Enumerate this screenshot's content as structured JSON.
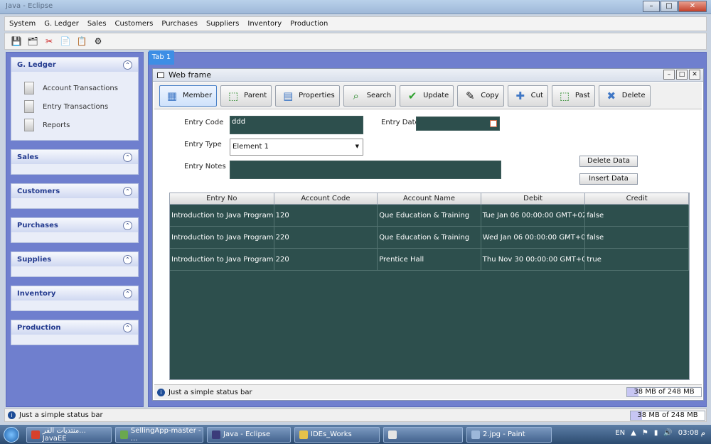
{
  "window": {
    "title": "Java - Eclipse"
  },
  "menu": [
    "System",
    "G. Ledger",
    "Sales",
    "Customers",
    "Purchases",
    "Suppliers",
    "Inventory",
    "Production"
  ],
  "sidebar": {
    "panels": [
      {
        "title": "G. Ledger",
        "items": [
          "Account Transactions",
          "Entry Transactions",
          "Reports"
        ]
      },
      {
        "title": "Sales"
      },
      {
        "title": "Customers"
      },
      {
        "title": "Purchases"
      },
      {
        "title": "Supplies"
      },
      {
        "title": "Inventory"
      },
      {
        "title": "Production"
      }
    ]
  },
  "tab": {
    "label": "Tab 1"
  },
  "webframe": {
    "title": "Web frame",
    "actions": [
      "Member",
      "Parent",
      "Properties",
      "Search",
      "Update",
      "Copy",
      "Cut",
      "Past",
      "Delete"
    ]
  },
  "form": {
    "entry_code_label": "Entry Code",
    "entry_code_value": "ddd",
    "entry_date_label": "Entry Date",
    "entry_date_value": "",
    "entry_type_label": "Entry Type",
    "entry_type_value": "Element 1",
    "entry_notes_label": "Entry Notes",
    "entry_notes_value": "",
    "delete_button": "Delete Data",
    "insert_button": "Insert Data"
  },
  "table": {
    "headers": [
      "Entry No",
      "Account Code",
      "Account Name",
      "Debit",
      "Credit"
    ],
    "rows": [
      [
        "Introduction to Java Programm...",
        "120",
        "Que Education & Training",
        "Tue Jan 06 00:00:00 GMT+02:...",
        "false"
      ],
      [
        "Introduction to Java Programm...",
        "220",
        "Que Education & Training",
        "Wed Jan 06 00:00:00 GMT+02...",
        "false"
      ],
      [
        "Introduction to Java Programm...",
        "220",
        "Prentice Hall",
        "Thu Nov 30 00:00:00 GMT+02...",
        "true"
      ]
    ]
  },
  "status": {
    "inner_text": "Just a simple status bar",
    "inner_mem": "38 MB of 248 MB",
    "outer_text": "Just a simple status bar",
    "outer_mem": "38 MB of 248 MB",
    "mem_fraction": 0.15
  },
  "taskbar": {
    "items": [
      "منتديات الفر... JavaEE",
      "SellingApp-master - ...",
      "Java - Eclipse",
      "IDEs_Works",
      "",
      "2.jpg - Paint"
    ],
    "lang": "EN",
    "clock": "03:08 م"
  }
}
